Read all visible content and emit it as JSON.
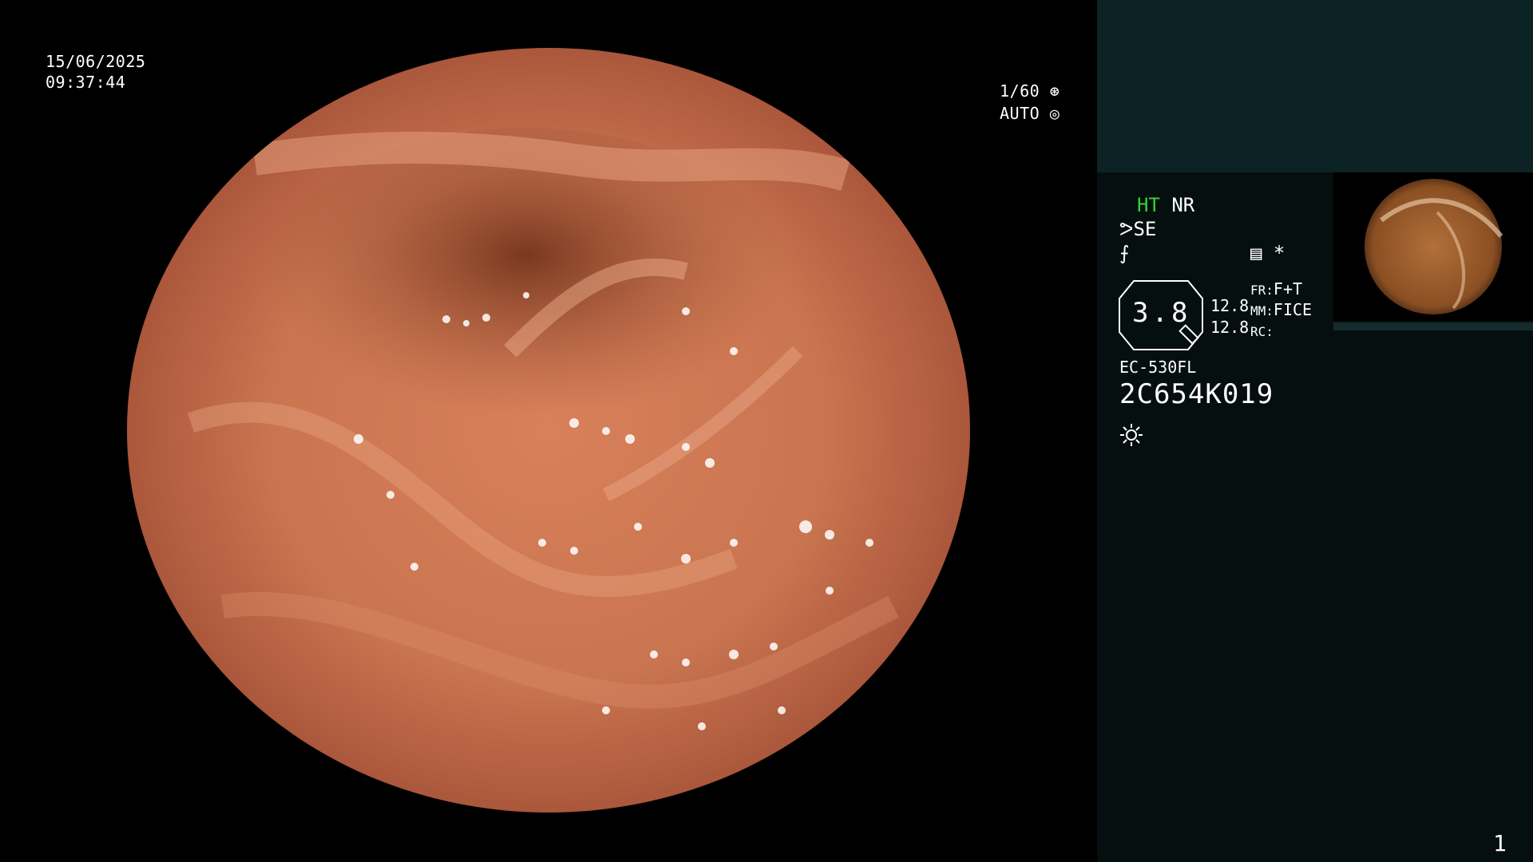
{
  "overlay": {
    "date": "15/06/2025",
    "time": "09:37:44",
    "shutter": "1/60",
    "iris": "AUTO"
  },
  "panel": {
    "mode_ht": "HT",
    "mode_nr": "NR",
    "se": "SE",
    "zoom": "3.8",
    "val1": "12.8",
    "val2": "12.8",
    "fr_label": "FR:",
    "fr_value": "F+T",
    "mm_label": "MM:",
    "mm_value": "FICE",
    "rc_label": "RC:",
    "rc_value": "",
    "model": "EC-530FL",
    "serial": "2C654K019",
    "page": "1"
  },
  "colors": {
    "panel_bg": "#050f0f",
    "panel_top": "#0c2224",
    "accent_green": "#35d235"
  },
  "icons": [
    "shutter-icon",
    "iris-icon",
    "scope-se-icon",
    "f-icon",
    "settings-icon",
    "asterisk-icon",
    "light-icon"
  ]
}
